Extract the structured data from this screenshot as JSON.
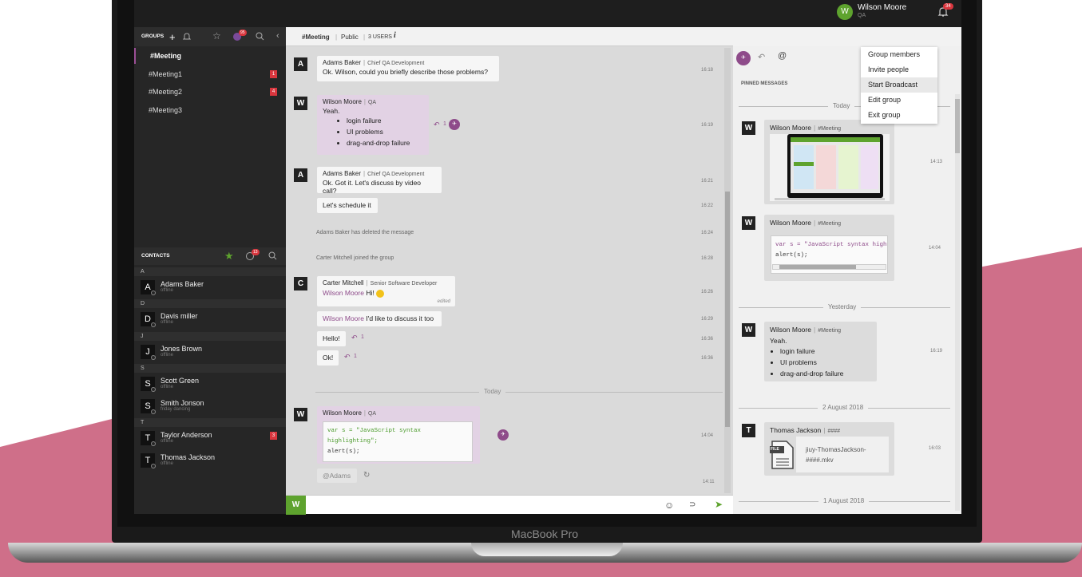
{
  "header": {
    "user_initial": "W",
    "user_name": "Wilson Moore",
    "user_role": "QA",
    "notif_count": "34"
  },
  "groups": {
    "label": "GROUPS",
    "badge": "95",
    "items": [
      {
        "name": "#Meeting",
        "count": ""
      },
      {
        "name": "#Meeting1",
        "count": "1"
      },
      {
        "name": "#Meeting2",
        "count": "4"
      },
      {
        "name": "#Meeting3",
        "count": ""
      }
    ]
  },
  "contacts": {
    "label": "CONTACTS",
    "badge": "13",
    "sections": [
      {
        "letter": "A",
        "people": [
          {
            "initial": "A",
            "name": "Adams Baker",
            "status": "offline",
            "count": ""
          }
        ]
      },
      {
        "letter": "D",
        "people": [
          {
            "initial": "D",
            "name": "Davis miller",
            "status": "offline",
            "count": ""
          }
        ]
      },
      {
        "letter": "J",
        "people": [
          {
            "initial": "J",
            "name": "Jones Brown",
            "status": "offline",
            "count": ""
          }
        ]
      },
      {
        "letter": "S",
        "people": [
          {
            "initial": "S",
            "name": "Scott Green",
            "status": "offline",
            "count": ""
          },
          {
            "initial": "S",
            "name": "Smith Jonson",
            "status": "friday dancing",
            "count": ""
          }
        ]
      },
      {
        "letter": "T",
        "people": [
          {
            "initial": "T",
            "name": "Taylor Anderson",
            "status": "offline",
            "count": "3"
          },
          {
            "initial": "T",
            "name": "Thomas Jackson",
            "status": "offline",
            "count": ""
          }
        ]
      }
    ]
  },
  "chat_head": {
    "channel": "#Meeting",
    "visibility": "Public",
    "users": "3 USERS"
  },
  "messages": {
    "m1": {
      "initial": "A",
      "sender": "Adams Baker",
      "role": "Chief QA Development",
      "text": "Ok. Wilson, could you briefly describe those problems?",
      "time": "16:18"
    },
    "m2": {
      "initial": "W",
      "sender": "Wilson Moore",
      "role": "QA",
      "text": "Yeah.",
      "bullets": [
        "login failure",
        "UI problems",
        "drag-and-drop failure"
      ],
      "reply_count": "1",
      "time": "16:19"
    },
    "m3": {
      "initial": "A",
      "sender": "Adams Baker",
      "role": "Chief QA Development",
      "text": "Ok. Got it. Let's discuss by video call?",
      "time": "16:21"
    },
    "m4": {
      "text": "Let's schedule it",
      "time": "16:22"
    },
    "sys1": {
      "text": "Adams Baker has deleted the message",
      "time": "16:24"
    },
    "sys2": {
      "text": "Carter Mitchell joined the group",
      "time": "16:28"
    },
    "m5": {
      "initial": "C",
      "sender": "Carter Mitchell",
      "role": "Senior Software Developer",
      "mention": "Wilson Moore",
      "text": "Hi!",
      "edited": "edited",
      "time": "16:26"
    },
    "m6": {
      "mention": "Wilson Moore",
      "text": "I'd like to discuss it too",
      "time": "16:29"
    },
    "m7": {
      "text": "Hello!",
      "reply_count": "1",
      "time": "16:36"
    },
    "m8": {
      "text": "Ok!",
      "reply_count": "1",
      "time": "16:36"
    },
    "today": "Today",
    "m9": {
      "initial": "W",
      "sender": "Wilson Moore",
      "role": "QA",
      "code_line1": "var s = \"JavaScript syntax highlighting\";",
      "code_line2": "alert(s);",
      "time": "14:04"
    },
    "m10": {
      "text": "@Adams",
      "time": "14:11"
    }
  },
  "input": {
    "initial": "W"
  },
  "right_panel": {
    "pinned_label": "PINNED MESSAGES",
    "today": "Today",
    "yesterday": "Yesterday",
    "date1": "2 August 2018",
    "date2": "1 August 2018",
    "c1": {
      "initial": "W",
      "sender": "Wilson Moore",
      "group": "#Meeting",
      "time": "14:13"
    },
    "c2": {
      "initial": "W",
      "sender": "Wilson Moore",
      "group": "#Meeting",
      "code_line1": "var s = \"JavaScript syntax highl",
      "code_line2": "alert(s);",
      "time": "14:04"
    },
    "c3": {
      "initial": "W",
      "sender": "Wilson Moore",
      "group": "#Meeting",
      "text": "Yeah.",
      "bullets": [
        "login failure",
        "UI problems",
        "drag-and-drop failure"
      ],
      "time": "16:19"
    },
    "c4": {
      "initial": "T",
      "sender": "Thomas Jackson",
      "group": "####",
      "file_label": "FILE",
      "file_name": "jiuy-ThomasJackson-####.mkv",
      "time": "16:03"
    }
  },
  "menu": {
    "items": [
      "Group members",
      "Invite people",
      "Start Broadcast",
      "Edit group",
      "Exit group"
    ]
  },
  "brand": "MacBook Pro",
  "colors": {
    "accent": "#8e4b8a",
    "green": "#5ea32e",
    "badge": "#d9363e",
    "pink": "#cf6f89"
  }
}
